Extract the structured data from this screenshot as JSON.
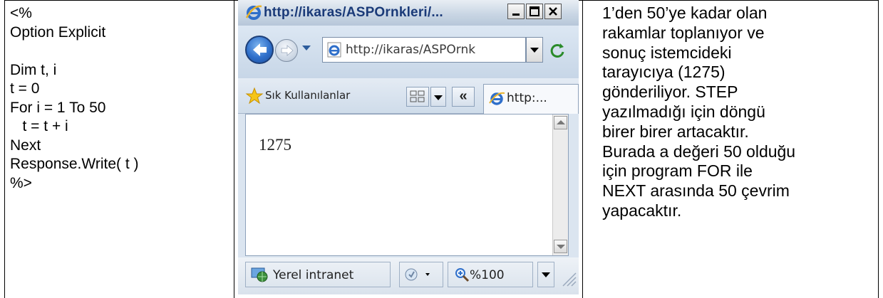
{
  "code_column": {
    "lines": [
      "<%",
      "Option Explicit",
      "",
      "Dim t, i",
      "t = 0",
      "For i = 1 To 50",
      "   t = t + i",
      "Next",
      "Response.Write( t )",
      "%>"
    ]
  },
  "browser": {
    "title": "http://ikaras/ASPOrnkleri/...",
    "address": "http://ikaras/ASPOrnk",
    "favorites_label": "Sık Kullanılanlar",
    "tab_label": "http:...",
    "page_output": "1275",
    "status_zone": "Yerel intranet",
    "zoom": "%100",
    "chevron": "«"
  },
  "description": {
    "lines": [
      "1’den 50’ye kadar olan",
      "rakamlar toplanıyor ve",
      "sonuç istemcideki",
      "tarayıcıya (1275)",
      "gönderiliyor. STEP",
      "yazılmadığı için döngü",
      "birer birer artacaktır.",
      "Burada a değeri 50 olduğu",
      "için program FOR ile",
      "NEXT arasında 50 çevrim",
      "yapacaktır."
    ]
  },
  "colors": {
    "title_text": "#1a3a78",
    "window_frame": "#dbe5f0",
    "ie_blue": "#2f6fca"
  }
}
